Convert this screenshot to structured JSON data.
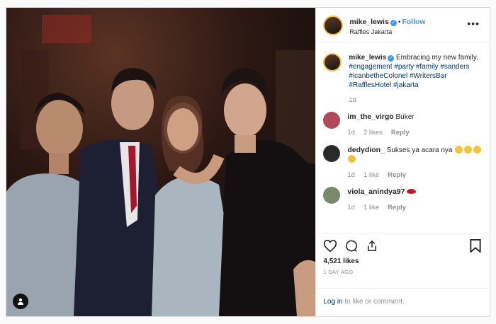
{
  "post": {
    "username": "mike_lewis",
    "follow_label": "Follow",
    "location": "Raffles Jakarta",
    "verified_mark": "✓"
  },
  "caption": {
    "username": "mike_lewis",
    "text": "Embracing my new family.",
    "hashtags": "#engagement #party #family #sanders #icanbetheColonel #WritersBar #RafflesHotel #jakarta",
    "age": "1d"
  },
  "comments": [
    {
      "username": "im_the_virgo",
      "text": "Buker",
      "age": "1d",
      "likes": "2 likes",
      "reply": "Reply",
      "avatar_color": "#b04a5a"
    },
    {
      "username": "dedydion_",
      "text": "Sukses ya acara nya",
      "age": "1d",
      "likes": "1 like",
      "reply": "Reply",
      "avatar_color": "#2a2a2a"
    },
    {
      "username": "viola_anindya97",
      "text": "",
      "age": "1d",
      "likes": "1 like",
      "reply": "Reply",
      "avatar_color": "#7a8a6a"
    }
  ],
  "stats": {
    "likes": "4,521 likes",
    "posted": "1 DAY AGO"
  },
  "login": {
    "link": "Log in",
    "rest": " to like or comment."
  },
  "icons": {
    "more": "more-options-icon",
    "like": "heart-icon",
    "comment": "comment-bubble-icon",
    "share": "share-icon",
    "save": "bookmark-icon",
    "tag": "user-tag-icon"
  },
  "colors": {
    "accent": "#3897f0",
    "hashtag": "#003569",
    "muted": "#8e8e8e"
  }
}
